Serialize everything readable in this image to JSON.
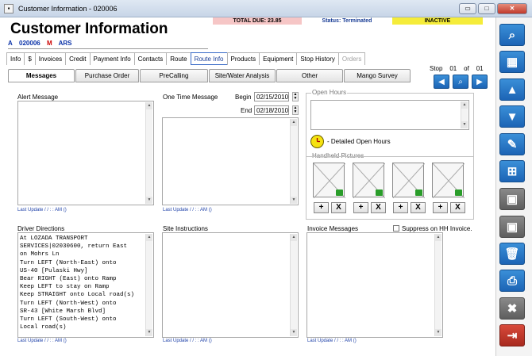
{
  "window": {
    "title": "Customer Information - 020006",
    "min": "▭",
    "max": "□",
    "close": "✕"
  },
  "status": {
    "total_due": "TOTAL DUE:  23.85",
    "status": "Status: Terminated",
    "state": "INACTIVE"
  },
  "header": {
    "title": "Customer Information",
    "type": "A",
    "code": "020006",
    "flag": "M",
    "route": "ARS"
  },
  "tabs_primary": [
    "Info",
    "$",
    "Invoices",
    "Credit",
    "Payment Info",
    "Contacts",
    "Route",
    "Route Info",
    "Products",
    "Equipment",
    "Stop History",
    "Orders"
  ],
  "tabs_secondary": [
    "Messages",
    "Purchase Order",
    "PreCalling",
    "Site/Water Analysis",
    "Other",
    "Mango Survey"
  ],
  "stop": {
    "label": "Stop",
    "current": "01",
    "of": "of",
    "total": "01"
  },
  "alert": {
    "label": "Alert Message",
    "last_update": "Last Update /  /       :   :   AM ()"
  },
  "onetime": {
    "label": "One Time Message",
    "begin_label": "Begin",
    "begin": "02/15/2010",
    "end_label": "End",
    "end": "02/18/2010",
    "last_update": "Last Update /  /       :   :   AM ()"
  },
  "openhours": {
    "label": "Open Hours",
    "detailed": "- Detailed Open Hours"
  },
  "handheld": {
    "label": "Handheld Pictures",
    "add": "+",
    "remove": "X"
  },
  "driver": {
    "label": "Driver Directions",
    "text": "At LOZADA TRANSPORT\nSERVICES|02030600, return East\non Mohrs Ln\nTurn LEFT (North-East) onto\nUS-40 [Pulaski Hwy]\nBear RIGHT (East) onto Ramp\nKeep LEFT to stay on Ramp\nKeep STRAIGHT onto Local road(s)\nTurn LEFT (North-West) onto\nSR-43 [White Marsh Blvd]\nTurn LEFT (South-West) onto\nLocal road(s)",
    "last_update": "Last Update /  /       :   :   AM ()"
  },
  "site": {
    "label": "Site Instructions",
    "last_update": "Last Update /  /       :   :   AM ()"
  },
  "invoice": {
    "label": "Invoice Messages",
    "suppress": "Suppress on HH Invoice.",
    "last_update": "Last Update /  /       :   :   AM ()"
  },
  "colors": {
    "accent": "#1c64b5",
    "due_bg": "#f6c6c6",
    "inactive_bg": "#f5ec3a"
  },
  "sidebar_icons": [
    "search-icon",
    "grid-icon",
    "arrow-up-icon",
    "arrow-down-icon",
    "pencil-icon",
    "add-document-icon",
    "save-new-icon",
    "save-icon",
    "trash-icon",
    "print-icon",
    "cancel-icon",
    "exit-icon"
  ]
}
